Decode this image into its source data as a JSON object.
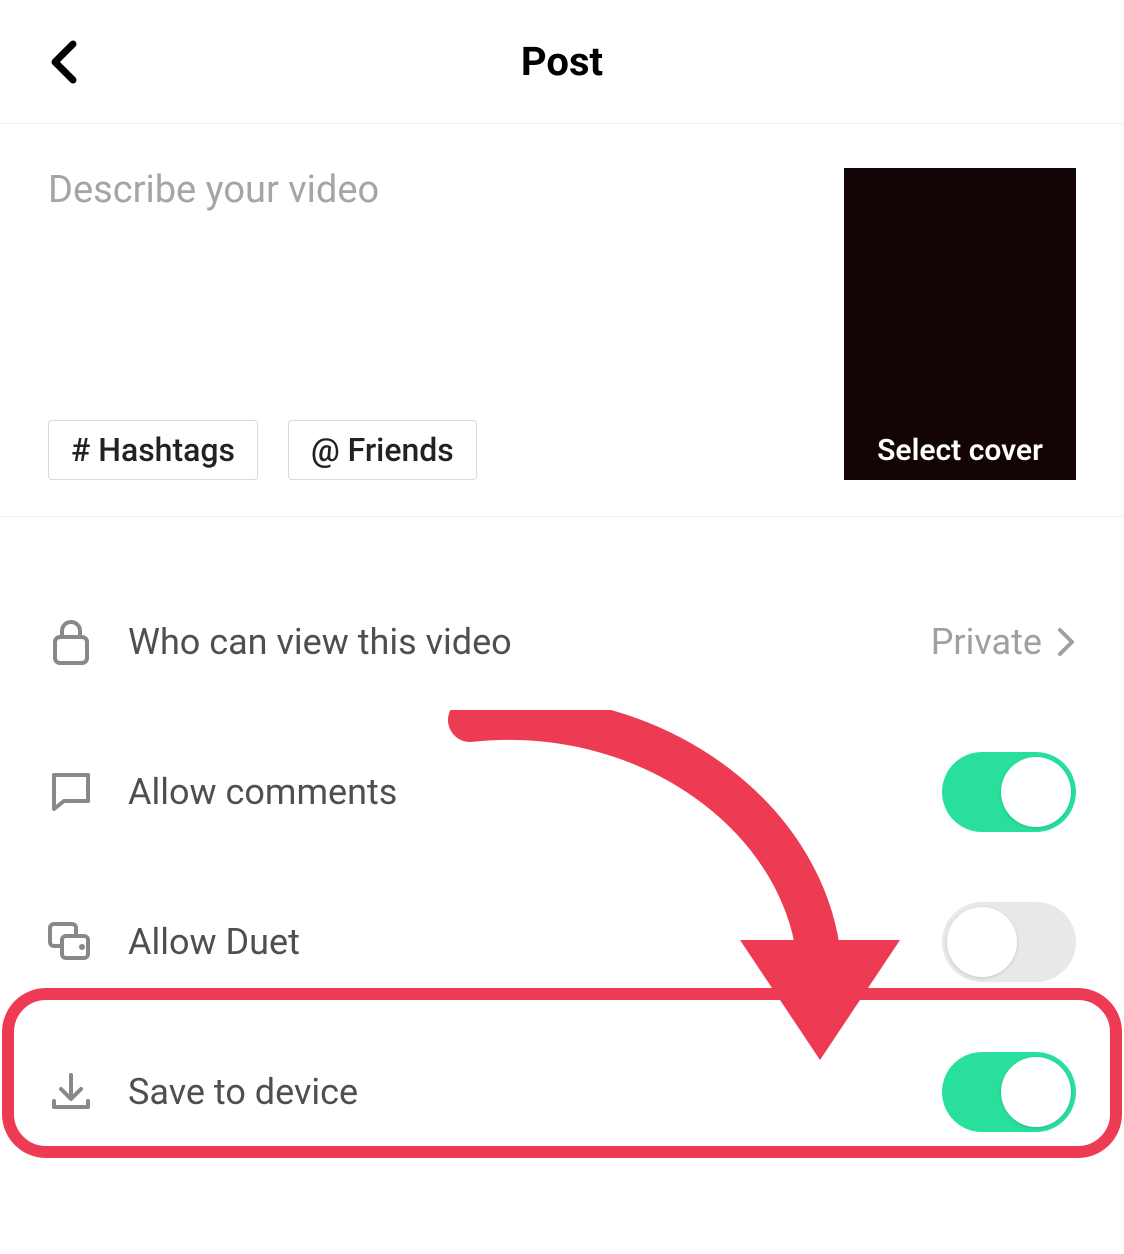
{
  "header": {
    "title": "Post"
  },
  "compose": {
    "placeholder": "Describe your video",
    "hashtags_label": "# Hashtags",
    "friends_label": "@ Friends",
    "cover_label": "Select cover"
  },
  "options": {
    "privacy": {
      "label": "Who can view this video",
      "value": "Private"
    },
    "comments": {
      "label": "Allow comments",
      "on": true
    },
    "duet": {
      "label": "Allow Duet",
      "on": false
    },
    "save": {
      "label": "Save to device",
      "on": true
    }
  },
  "colors": {
    "toggle_on": "#28e09b",
    "annotation": "#ee3b54"
  }
}
